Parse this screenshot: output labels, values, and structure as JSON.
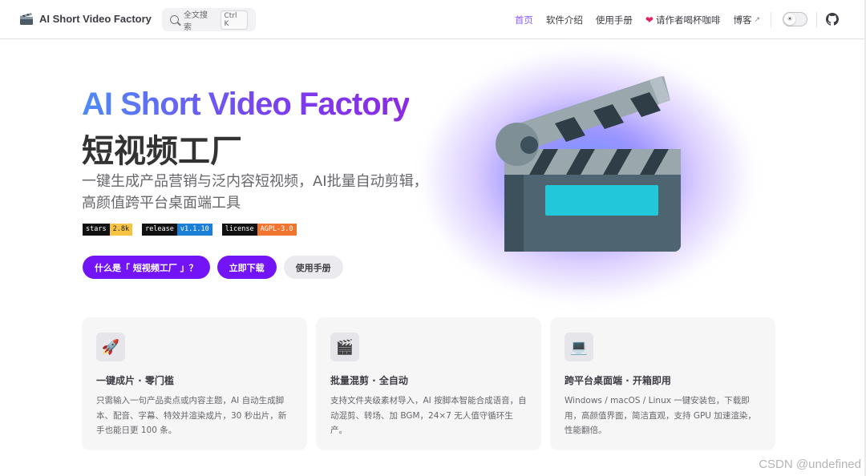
{
  "nav": {
    "brand": "AI Short Video Factory",
    "search_placeholder": "全文搜索",
    "search_shortcut": "Ctrl K",
    "links": [
      {
        "label": "首页",
        "active": true
      },
      {
        "label": "软件介绍"
      },
      {
        "label": "使用手册"
      },
      {
        "label": "请作者喝杯咖啡",
        "icon": "heart-icon"
      },
      {
        "label": "博客",
        "icon": "external-link-icon"
      }
    ],
    "theme_toggle_icon": "sun-icon",
    "github_icon": "github-icon"
  },
  "hero": {
    "title_en": "AI Short Video Factory",
    "title_cn": "短视频工厂",
    "tagline": "一键生成产品营销与泛内容短视频，AI批量自动剪辑，高颜值跨平台桌面端工具",
    "badges": [
      {
        "key": "stars",
        "value": "2.8k",
        "color": "#f6c343"
      },
      {
        "key": "release",
        "value": "v1.1.10",
        "color": "#1b7fd6"
      },
      {
        "key": "license",
        "value": "AGPL-3.0",
        "color": "#f0762f"
      }
    ],
    "buttons": [
      {
        "label": "什么是「 短视频工厂 」？",
        "style": "brand"
      },
      {
        "label": "立即下载",
        "style": "brand"
      },
      {
        "label": "使用手册",
        "style": "alt"
      }
    ],
    "illustration": "clapperboard-icon"
  },
  "features": [
    {
      "icon": "🚀",
      "title": "一键成片 · 零门槛",
      "desc": "只需输入一句产品卖点或内容主题，AI 自动生成脚本、配音、字幕、特效并渲染成片，30 秒出片，新手也能日更 100 条。"
    },
    {
      "icon": "🎬",
      "title": "批量混剪 · 全自动",
      "desc": "支持文件夹级素材导入，AI 按脚本智能合成语音，自动混剪、转场、加 BGM，24×7 无人值守循环生产。"
    },
    {
      "icon": "💻",
      "title": "跨平台桌面端 · 开箱即用",
      "desc": "Windows / macOS / Linux 一键安装包，下载即用，高颜值界面，简洁直观，支持 GPU 加速渲染，性能翻倍。"
    }
  ],
  "watermark": "CSDN @undefined",
  "colors": {
    "brand": "#7214f5",
    "active_link": "#8b5cf6"
  }
}
